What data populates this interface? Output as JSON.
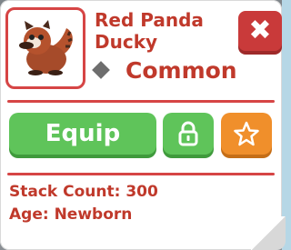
{
  "pet": {
    "name_line1": "Red Panda",
    "name_line2": "Ducky",
    "rarity": "Common"
  },
  "actions": {
    "equip_label": "Equip",
    "close_symbol": "✖"
  },
  "stats": {
    "stack_count": "Stack Count: 300",
    "age": "Age: Newborn"
  },
  "icons": {
    "close": "close-icon",
    "lock": "lock-icon",
    "favorite": "star-icon",
    "rarity": "diamond-icon"
  },
  "colors": {
    "accent_red": "#c0392b",
    "button_green": "#5fc45a",
    "button_orange": "#f08f2b"
  }
}
